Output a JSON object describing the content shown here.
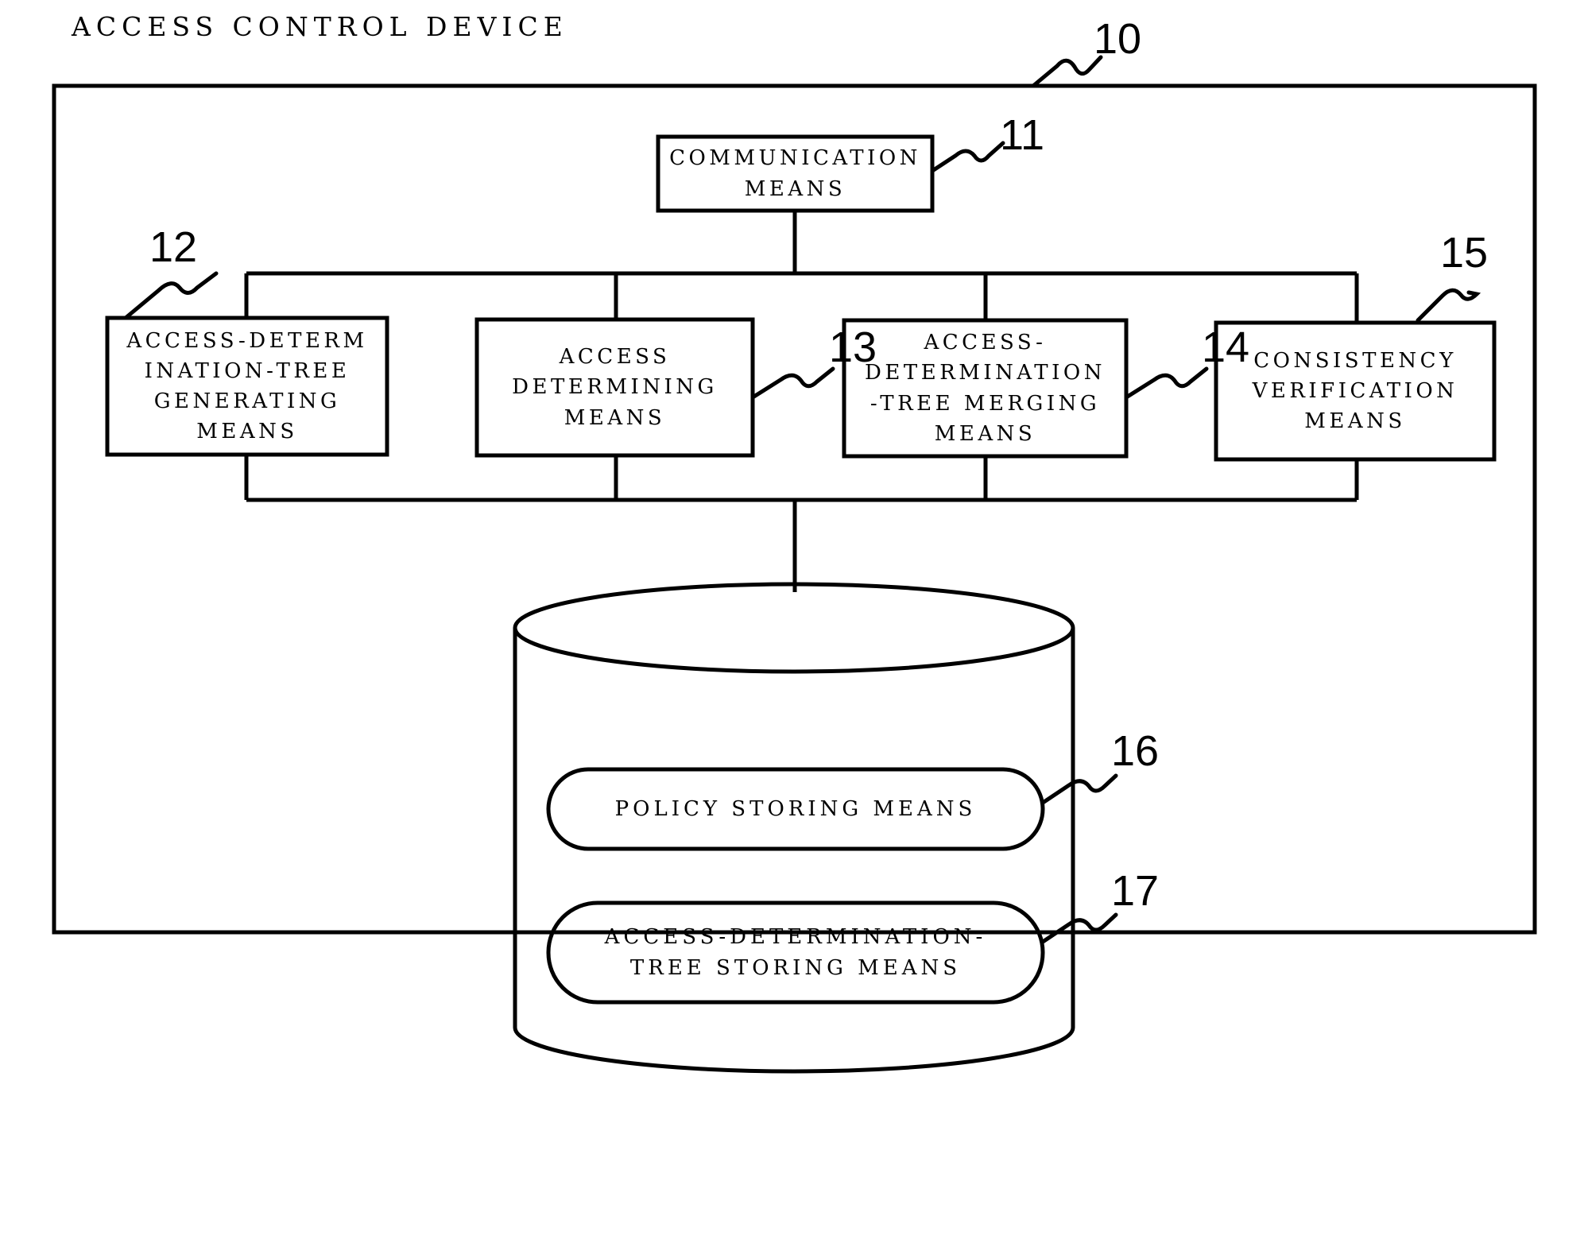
{
  "figure": {
    "title": "ACCESS CONTROL DEVICE",
    "outer_ref": "10"
  },
  "blocks": {
    "communication": {
      "ref": "11",
      "lines": [
        "COMMUNICATION",
        "MEANS"
      ]
    },
    "tree_generating": {
      "ref": "12",
      "lines": [
        "ACCESS-DETERM",
        "INATION-TREE",
        "GENERATING",
        "MEANS"
      ]
    },
    "access_determining": {
      "ref": "13",
      "lines": [
        "ACCESS",
        "DETERMINING",
        "MEANS"
      ]
    },
    "tree_merging": {
      "ref": "14",
      "lines": [
        "ACCESS-",
        "DETERMINATION",
        "-TREE MERGING",
        "MEANS"
      ]
    },
    "consistency": {
      "ref": "15",
      "lines": [
        "CONSISTENCY",
        "VERIFICATION",
        "MEANS"
      ]
    }
  },
  "storage": {
    "policy_store": {
      "ref": "16",
      "lines": [
        "POLICY STORING MEANS"
      ]
    },
    "tree_store": {
      "ref": "17",
      "lines": [
        "ACCESS-DETERMINATION-",
        "TREE STORING MEANS"
      ]
    }
  },
  "colors": {
    "ink": "#000000",
    "paper": "#ffffff"
  }
}
